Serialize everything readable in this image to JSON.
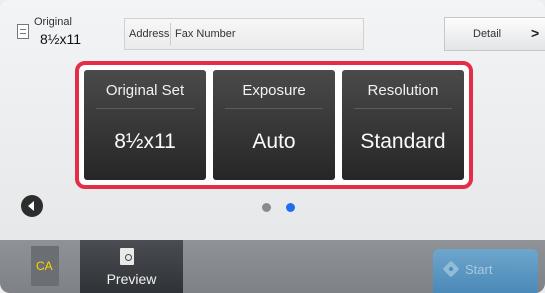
{
  "header": {
    "original_label": "Original",
    "original_size": "8½x11",
    "address_label": "Address",
    "fax_number_label": "Fax Number",
    "detail_label": "Detail",
    "detail_arrow": ">"
  },
  "settings": [
    {
      "label": "Original Set",
      "value": "8½x11"
    },
    {
      "label": "Exposure",
      "value": "Auto"
    },
    {
      "label": "Resolution",
      "value": "Standard"
    }
  ],
  "pagination": {
    "current_page": 2,
    "total_pages": 2
  },
  "bottom": {
    "ca_label": "CA",
    "preview_label": "Preview",
    "start_label": "Start"
  },
  "colors": {
    "highlight": "#e42e48",
    "active_dot": "#1e6ff0",
    "ca_text": "#ffd700",
    "start_button": "#3a8cc9"
  }
}
